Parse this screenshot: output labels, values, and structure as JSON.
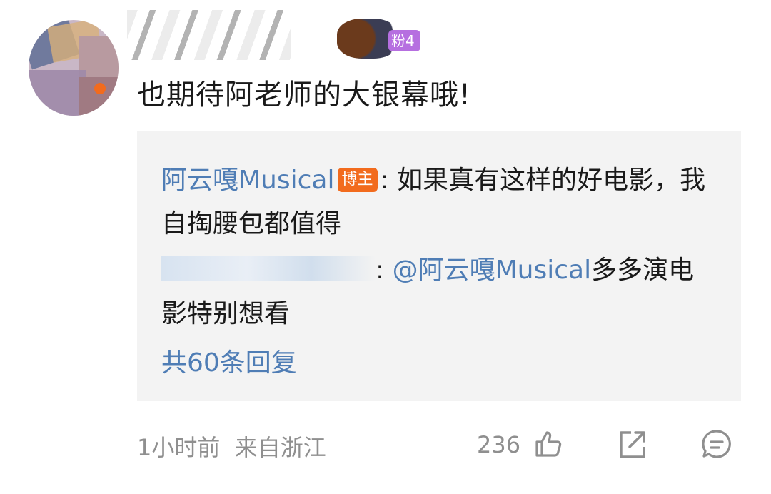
{
  "comment": {
    "fan_badge": "粉4",
    "text": "也期待阿老师的大银幕哦!"
  },
  "reply_box": {
    "reply1": {
      "author": "阿云嘎Musical",
      "author_tag": "博主",
      "separator": ": ",
      "text": "如果真有这样的好电影，我自掏腰包都值得"
    },
    "reply2": {
      "separator": ": ",
      "mention": "@阿云嘎Musical",
      "text": "多多演电影特别想看"
    },
    "total_replies": "共60条回复"
  },
  "footer": {
    "time": "1小时前",
    "location": "来自浙江",
    "like_count": "236"
  },
  "colors": {
    "link": "#4f7db5",
    "blogger_tag": "#f26b1d",
    "fan_badge": "#b66fe0"
  }
}
